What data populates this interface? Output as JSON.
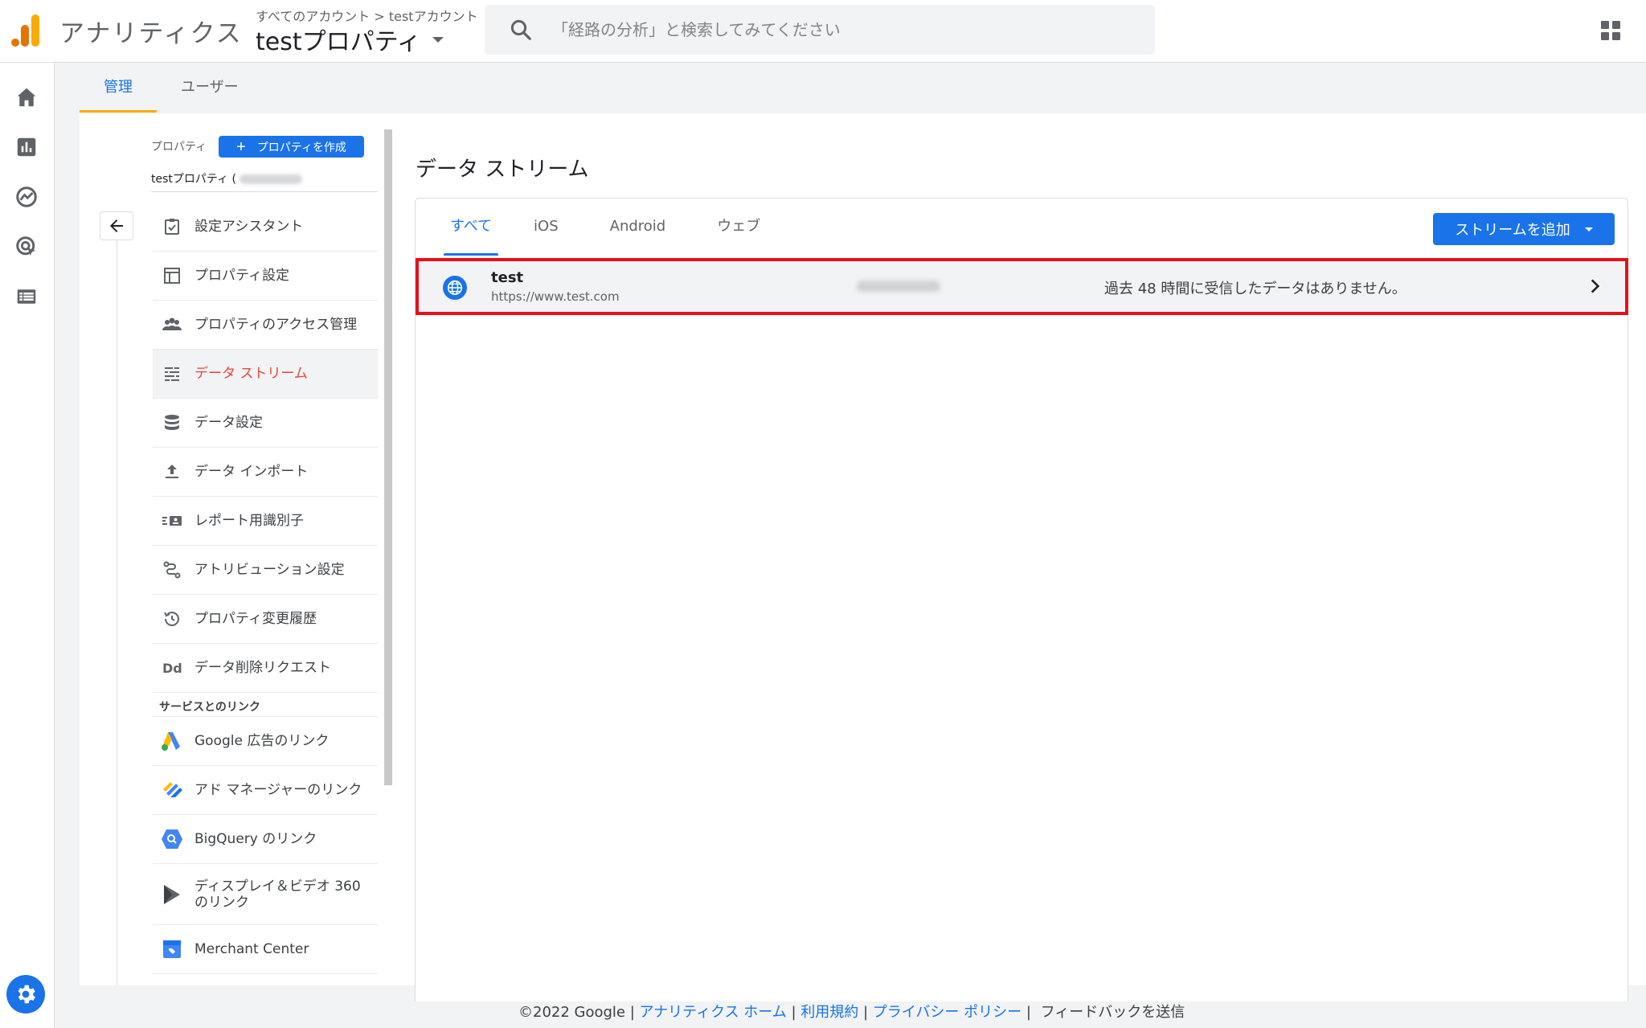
{
  "header": {
    "app_title": "アナリティクス",
    "breadcrumb_account_all": "すべてのアカウント",
    "breadcrumb_separator": ">",
    "breadcrumb_account": "testアカウント",
    "property_title": "testプロパティ",
    "search_placeholder": "「経路の分析」と検索してみてください"
  },
  "admin_tabs": [
    {
      "label": "管理",
      "active": true
    },
    {
      "label": "ユーザー",
      "active": false
    }
  ],
  "property_column": {
    "label": "プロパティ",
    "create_button": "プロパティを作成",
    "property_name": "testプロパティ ("
  },
  "nav": {
    "items": [
      {
        "label": "設定アシスタント",
        "icon": "clipboard-check-icon"
      },
      {
        "label": "プロパティ設定",
        "icon": "layout-icon"
      },
      {
        "label": "プロパティのアクセス管理",
        "icon": "people-icon"
      },
      {
        "label": "データ ストリーム",
        "icon": "streams-icon",
        "active": true
      },
      {
        "label": "データ設定",
        "icon": "database-icon"
      },
      {
        "label": "データ インポート",
        "icon": "upload-icon"
      },
      {
        "label": "レポート用識別子",
        "icon": "id-card-icon"
      },
      {
        "label": "アトリビューション設定",
        "icon": "attribution-icon"
      },
      {
        "label": "プロパティ変更履歴",
        "icon": "history-icon"
      },
      {
        "label": "データ削除リクエスト",
        "icon": "dd-icon"
      }
    ],
    "section_links": "サービスとのリンク",
    "link_items": [
      {
        "label": "Google 広告のリンク",
        "icon": "google-ads-icon"
      },
      {
        "label": "アド マネージャーのリンク",
        "icon": "ad-manager-icon"
      },
      {
        "label": "BigQuery のリンク",
        "icon": "bigquery-icon"
      },
      {
        "label": "ディスプレイ＆ビデオ 360 のリンク",
        "icon": "dv360-icon"
      },
      {
        "label": "Merchant Center",
        "icon": "merchant-center-icon"
      }
    ]
  },
  "panel": {
    "title": "データ ストリーム",
    "tabs": [
      {
        "label": "すべて",
        "active": true
      },
      {
        "label": "iOS",
        "active": false
      },
      {
        "label": "Android",
        "active": false
      },
      {
        "label": "ウェブ",
        "active": false
      }
    ],
    "add_stream_button": "ストリームを追加",
    "streams": [
      {
        "name": "test",
        "url": "https://www.test.com",
        "status": "過去 48 時間に受信したデータはありません。",
        "icon": "globe-icon"
      }
    ]
  },
  "footer": {
    "copyright": "©2022 Google",
    "sep": " | ",
    "links": [
      "アナリティクス ホーム",
      "利用規約",
      "プライバシー ポリシー"
    ],
    "feedback": "フィードバックを送信"
  },
  "colors": {
    "accent": "#1a73e8",
    "active_nav": "#e8453c",
    "highlight_border": "#e8101a",
    "tab_indicator": "#f9ab00"
  }
}
